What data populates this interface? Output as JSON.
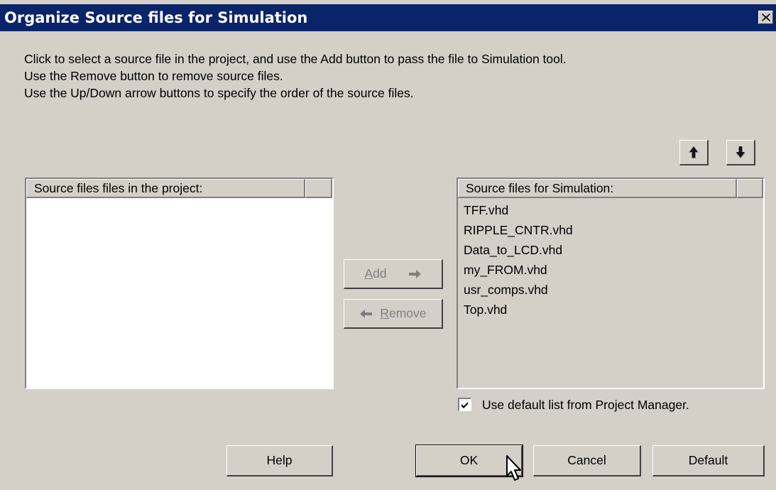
{
  "window": {
    "title": "Organize Source files for Simulation"
  },
  "instructions": [
    "Click to select a source file in the project, and use the Add button to pass the file to Simulation tool.",
    "Use the Remove button to remove source files.",
    "Use the Up/Down arrow buttons to specify the order of the source files."
  ],
  "project_list": {
    "header": "Source files files in the project:",
    "items": []
  },
  "simulation_list": {
    "header": "Source files for Simulation:",
    "items": [
      "TFF.vhd",
      "RIPPLE_CNTR.vhd",
      "Data_to_LCD.vhd",
      "my_FROM.vhd",
      "usr_comps.vhd",
      "Top.vhd"
    ]
  },
  "buttons": {
    "add_prefix": "",
    "add_mnemonic": "A",
    "add_rest": "dd",
    "remove_mnemonic": "R",
    "remove_rest": "emove",
    "help": "Help",
    "ok": "OK",
    "cancel": "Cancel",
    "default": "Default"
  },
  "checkbox": {
    "label": "Use default list from Project Manager.",
    "checked": true
  },
  "icons": {
    "up": "arrow-up-icon",
    "down": "arrow-down-icon",
    "add_arrow": "arrow-right-icon",
    "remove_arrow": "arrow-left-icon",
    "close": "close-icon"
  },
  "colors": {
    "titlebar": "#0a246a",
    "face": "#d4d0c8",
    "disabled_text": "#808080"
  }
}
